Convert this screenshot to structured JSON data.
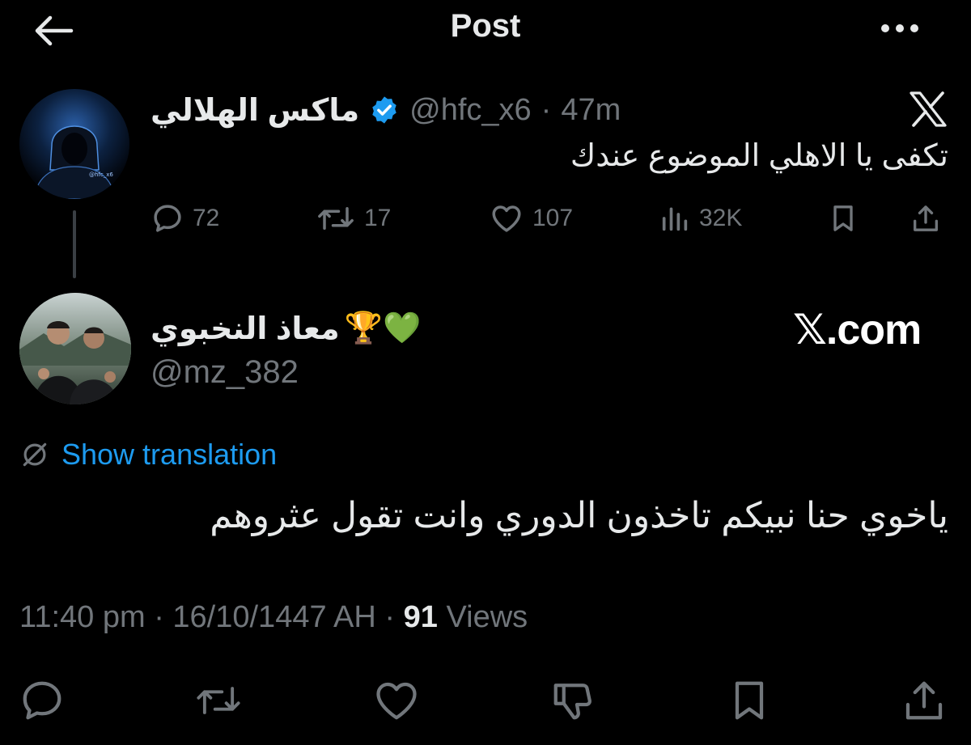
{
  "header": {
    "title": "Post"
  },
  "parent_tweet": {
    "name": "ماكس الهلالي",
    "handle": "@hfc_x6",
    "separator": "·",
    "time": "47m",
    "text": "تكفى يا الاهلي الموضوع عندك",
    "avatar_caption": "@hfc_x6",
    "stats": {
      "replies": "72",
      "reposts": "17",
      "likes": "107",
      "views": "32K"
    },
    "verified": true
  },
  "reply_tweet": {
    "name": "معاذ النخبوي",
    "name_emoji": "💚🏆",
    "handle": "@mz_382",
    "translate_label": "Show translation",
    "text": "ياخوي حنا نبيكم تاخذون الدوري وانت تقول عثروهم",
    "timestamp": "11:40 pm",
    "date": "16/10/1447 AH",
    "views_count": "91",
    "views_label": "Views"
  },
  "watermark": "𝕏.com",
  "colors": {
    "background": "#000000",
    "text_primary": "#e7e9ea",
    "text_secondary": "#71767b",
    "accent": "#1d9bf0",
    "verified": "#1d9bf0"
  },
  "icons": {
    "header": [
      "back-arrow-icon",
      "more-icon"
    ],
    "parent_actions": [
      "reply-icon",
      "repost-icon",
      "like-icon",
      "views-icon",
      "bookmark-icon",
      "share-icon"
    ],
    "bottom_bar": [
      "reply-icon",
      "repost-icon",
      "like-icon",
      "dislike-icon",
      "bookmark-icon",
      "share-icon"
    ]
  }
}
